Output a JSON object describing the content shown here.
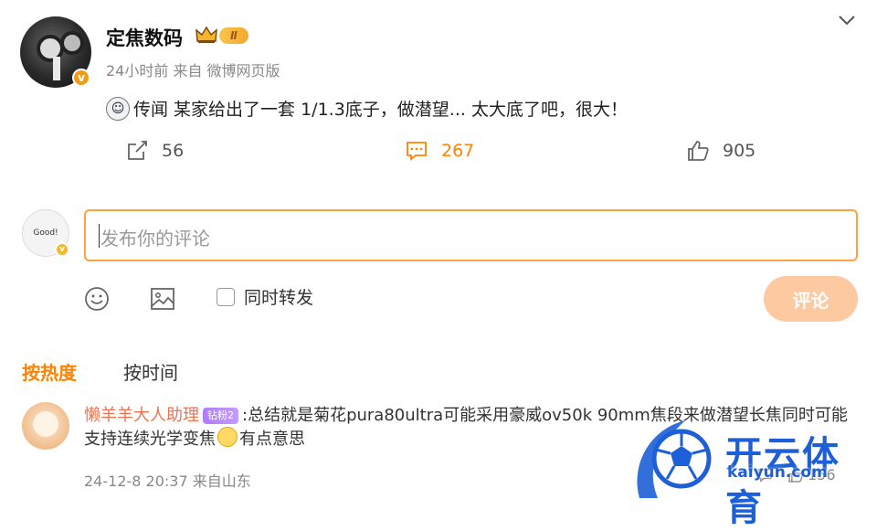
{
  "post": {
    "username": "定焦数码",
    "level": "Ⅱ",
    "meta": "24小时前  来自  微博网页版",
    "text": "传闻 某家给出了一套 1/1.3底子，做潜望... 太大底了吧，很大！",
    "actions": {
      "share_count": "56",
      "comment_count": "267",
      "like_count": "905"
    }
  },
  "composer": {
    "placeholder": "发布你的评论",
    "repost_label": "同时转发",
    "submit_label": "评论",
    "avatar_text": "Good!"
  },
  "sort_tabs": {
    "hot": "按热度",
    "time": "按时间"
  },
  "comment": {
    "author": "懒羊羊大人助理",
    "fan_badge": "钻粉2",
    "text": ":总结就是菊花pura80ultra可能采用豪威ov50k 90mm焦段来做潜望长焦同时可能支持连续光学变焦",
    "text_tail": "有点意思",
    "meta": "24-12-8 20:37  来自山东",
    "like_count": "156"
  },
  "watermark": {
    "brand": "开云体育",
    "url": "kaiyun.com"
  },
  "colors": {
    "accent": "#ff8200",
    "input_border": "#ffa142",
    "submit_bg": "#fcc9a1",
    "link_name": "#eb7350",
    "watermark": "#1d5fd6"
  },
  "icons": [
    "chevron-down-icon",
    "verified-icon",
    "crown-icon",
    "ghost-emoji-icon",
    "share-icon",
    "comment-icon",
    "like-icon",
    "emoji-icon",
    "image-icon",
    "checkbox-icon",
    "reply-icon"
  ]
}
